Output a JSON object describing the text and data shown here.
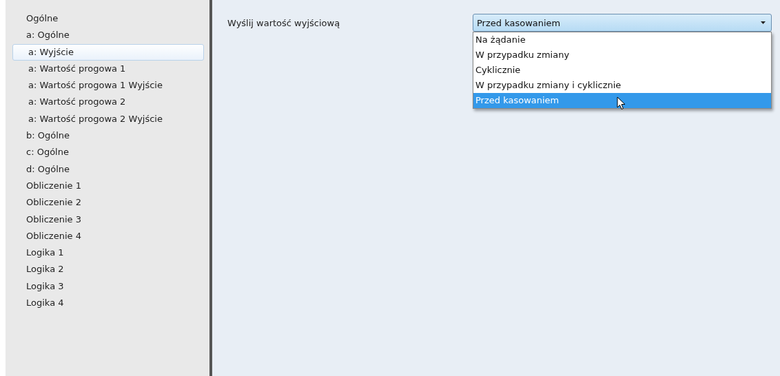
{
  "sidebar": {
    "items": [
      {
        "label": "Ogólne",
        "selected": false
      },
      {
        "label": "a: Ogólne",
        "selected": false,
        "children": [
          {
            "label": "a: Wyjście",
            "selected": true
          },
          {
            "label": "a: Wartość progowa 1",
            "selected": false
          },
          {
            "label": "a: Wartość progowa 1 Wyjście",
            "selected": false
          },
          {
            "label": "a: Wartość progowa 2",
            "selected": false
          },
          {
            "label": "a: Wartość progowa 2 Wyjście",
            "selected": false
          }
        ]
      },
      {
        "label": "b: Ogólne",
        "selected": false
      },
      {
        "label": "c: Ogólne",
        "selected": false
      },
      {
        "label": "d: Ogólne",
        "selected": false
      },
      {
        "label": "Obliczenie 1",
        "selected": false
      },
      {
        "label": "Obliczenie 2",
        "selected": false
      },
      {
        "label": "Obliczenie 3",
        "selected": false
      },
      {
        "label": "Obliczenie 4",
        "selected": false
      },
      {
        "label": "Logika 1",
        "selected": false
      },
      {
        "label": "Logika 2",
        "selected": false
      },
      {
        "label": "Logika 3",
        "selected": false
      },
      {
        "label": "Logika 4",
        "selected": false
      }
    ]
  },
  "parameter": {
    "label": "Wyślij wartość wyjściową",
    "value": "Przed kasowaniem",
    "expanded": true,
    "options": [
      {
        "label": "Na żądanie",
        "selected": false
      },
      {
        "label": "W przypadku zmiany",
        "selected": false
      },
      {
        "label": "Cyklicznie",
        "selected": false
      },
      {
        "label": "W przypadku zmiany i cyklicznie",
        "selected": false
      },
      {
        "label": "Przed kasowaniem",
        "selected": true
      }
    ]
  }
}
